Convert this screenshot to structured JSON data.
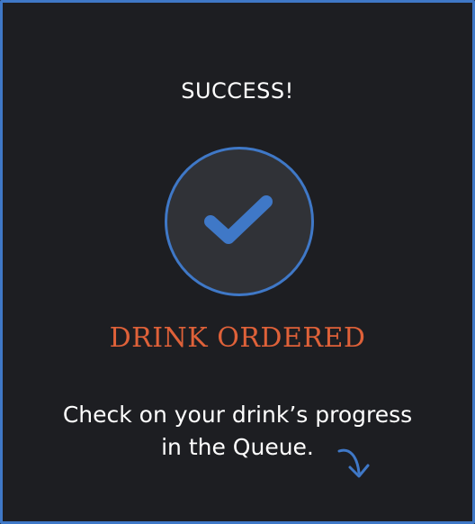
{
  "dialog": {
    "title": "SUCCESS!",
    "status_icon": "checkmark-icon",
    "headline": "DRINK ORDERED",
    "message_line1": "Check on your drink’s progress",
    "message_line2": "in the Queue.",
    "pointer_icon": "curved-arrow-down-icon"
  },
  "colors": {
    "background": "#1d1e22",
    "accent_blue": "#3f78c7",
    "headline_orange": "#df6139",
    "text": "#ffffff",
    "circle_fill": "#303237"
  }
}
